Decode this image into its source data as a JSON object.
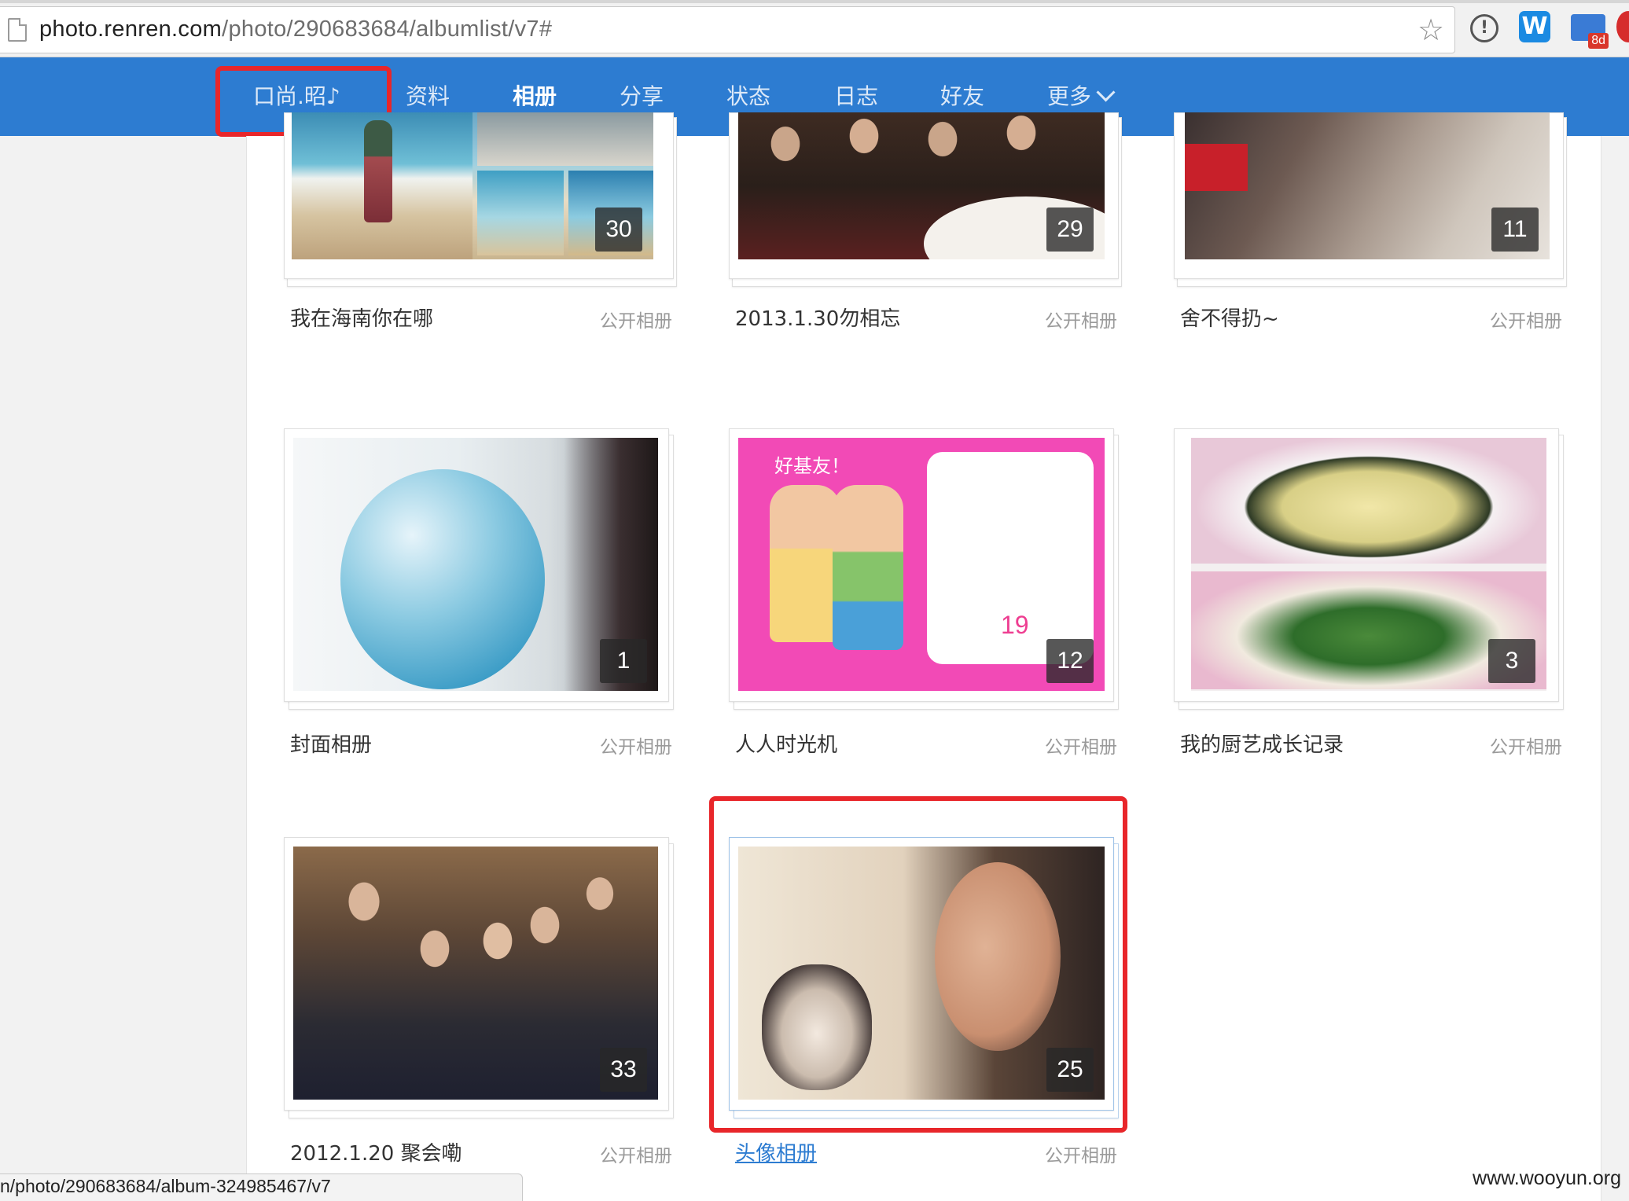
{
  "browser": {
    "url_host": "photo.renren.com",
    "url_path": "/photo/290683684/albumlist/v7#",
    "status_url": "n/photo/290683684/album-324985467/v7",
    "ext_badge": "8d"
  },
  "nav": {
    "username": "口尚.昭♪",
    "items": [
      "资料",
      "相册",
      "分享",
      "状态",
      "日志",
      "好友",
      "更多"
    ],
    "active": "相册"
  },
  "albums": [
    {
      "title": "我在海南你在哪",
      "visibility": "公开相册",
      "count": "30"
    },
    {
      "title": "2013.1.30勿相忘",
      "visibility": "公开相册",
      "count": "29"
    },
    {
      "title": "舍不得扔~",
      "visibility": "公开相册",
      "count": "11"
    },
    {
      "title": "封面相册",
      "visibility": "公开相册",
      "count": "1"
    },
    {
      "title": "人人时光机",
      "visibility": "公开相册",
      "count": "12"
    },
    {
      "title": "我的厨艺成长记录",
      "visibility": "公开相册",
      "count": "3"
    },
    {
      "title": "2012.1.20 聚会嘞",
      "visibility": "公开相册",
      "count": "33"
    },
    {
      "title": "头像相册",
      "visibility": "公开相册",
      "count": "25"
    }
  ],
  "timecard": {
    "heading": "好基友！",
    "days": "19"
  },
  "watermark": "www.wooyun.org",
  "colors": {
    "nav_bg": "#2d7cd1",
    "highlight": "#e8262a",
    "link": "#2d7cd1"
  }
}
